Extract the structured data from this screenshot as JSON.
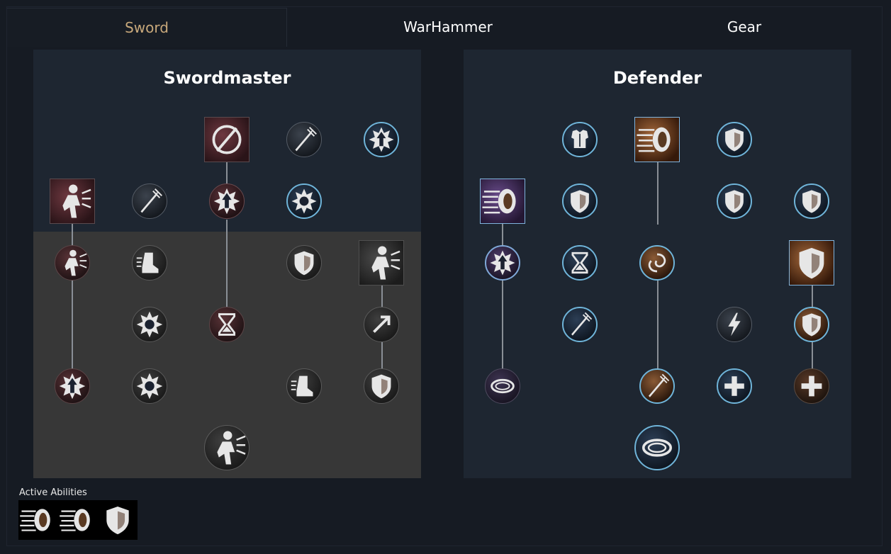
{
  "tabs": [
    {
      "label": "Sword",
      "active": true
    },
    {
      "label": "WarHammer",
      "active": false
    },
    {
      "label": "Gear",
      "active": false
    }
  ],
  "trees": {
    "sword": {
      "title": "Swordmaster",
      "nodes": [
        "whirling-slash-icon",
        "crossed-dagger-icon",
        "empower-arrow-icon",
        "lunge-icon",
        "blade-icon",
        "empower-arrow-icon",
        "spiral-burst-icon",
        "dash-icon",
        "armored-boot-icon",
        "shield-wing-icon",
        "leap-icon",
        "sunburst-icon",
        "hourglass-icon",
        "arrow-up-icon",
        "empower-arrow-icon",
        "cross-burst-icon",
        "running-boot-icon",
        "gauntlet-icon",
        "roar-icon"
      ]
    },
    "defender": {
      "title": "Defender",
      "nodes": [
        "armor-icon",
        "shield-rush-icon",
        "helmet-icon",
        "shield-bash-icon",
        "frost-axe-icon",
        "shield-down-icon",
        "shield-slash-icon",
        "empower-arrow-icon",
        "hourglass-icon",
        "vortex-icon",
        "kite-shield-icon",
        "blade-icon",
        "lightning-icon",
        "defense-badge-icon",
        "orbit-stars-icon",
        "gauntlet-icon",
        "heal-cross-icon",
        "heal-cross-icon",
        "spin-circle-icon"
      ]
    }
  },
  "active_abilities": {
    "label": "Active Abilities",
    "slots": [
      "shield-bash-icon",
      "shield-rush-icon",
      "kite-shield-icon"
    ]
  },
  "colors": {
    "background": "#161b23",
    "panel": "#1e2631",
    "locked_region": "#373737",
    "active_tab": "#c8a87b",
    "node_ring": "#6fb4d9"
  }
}
